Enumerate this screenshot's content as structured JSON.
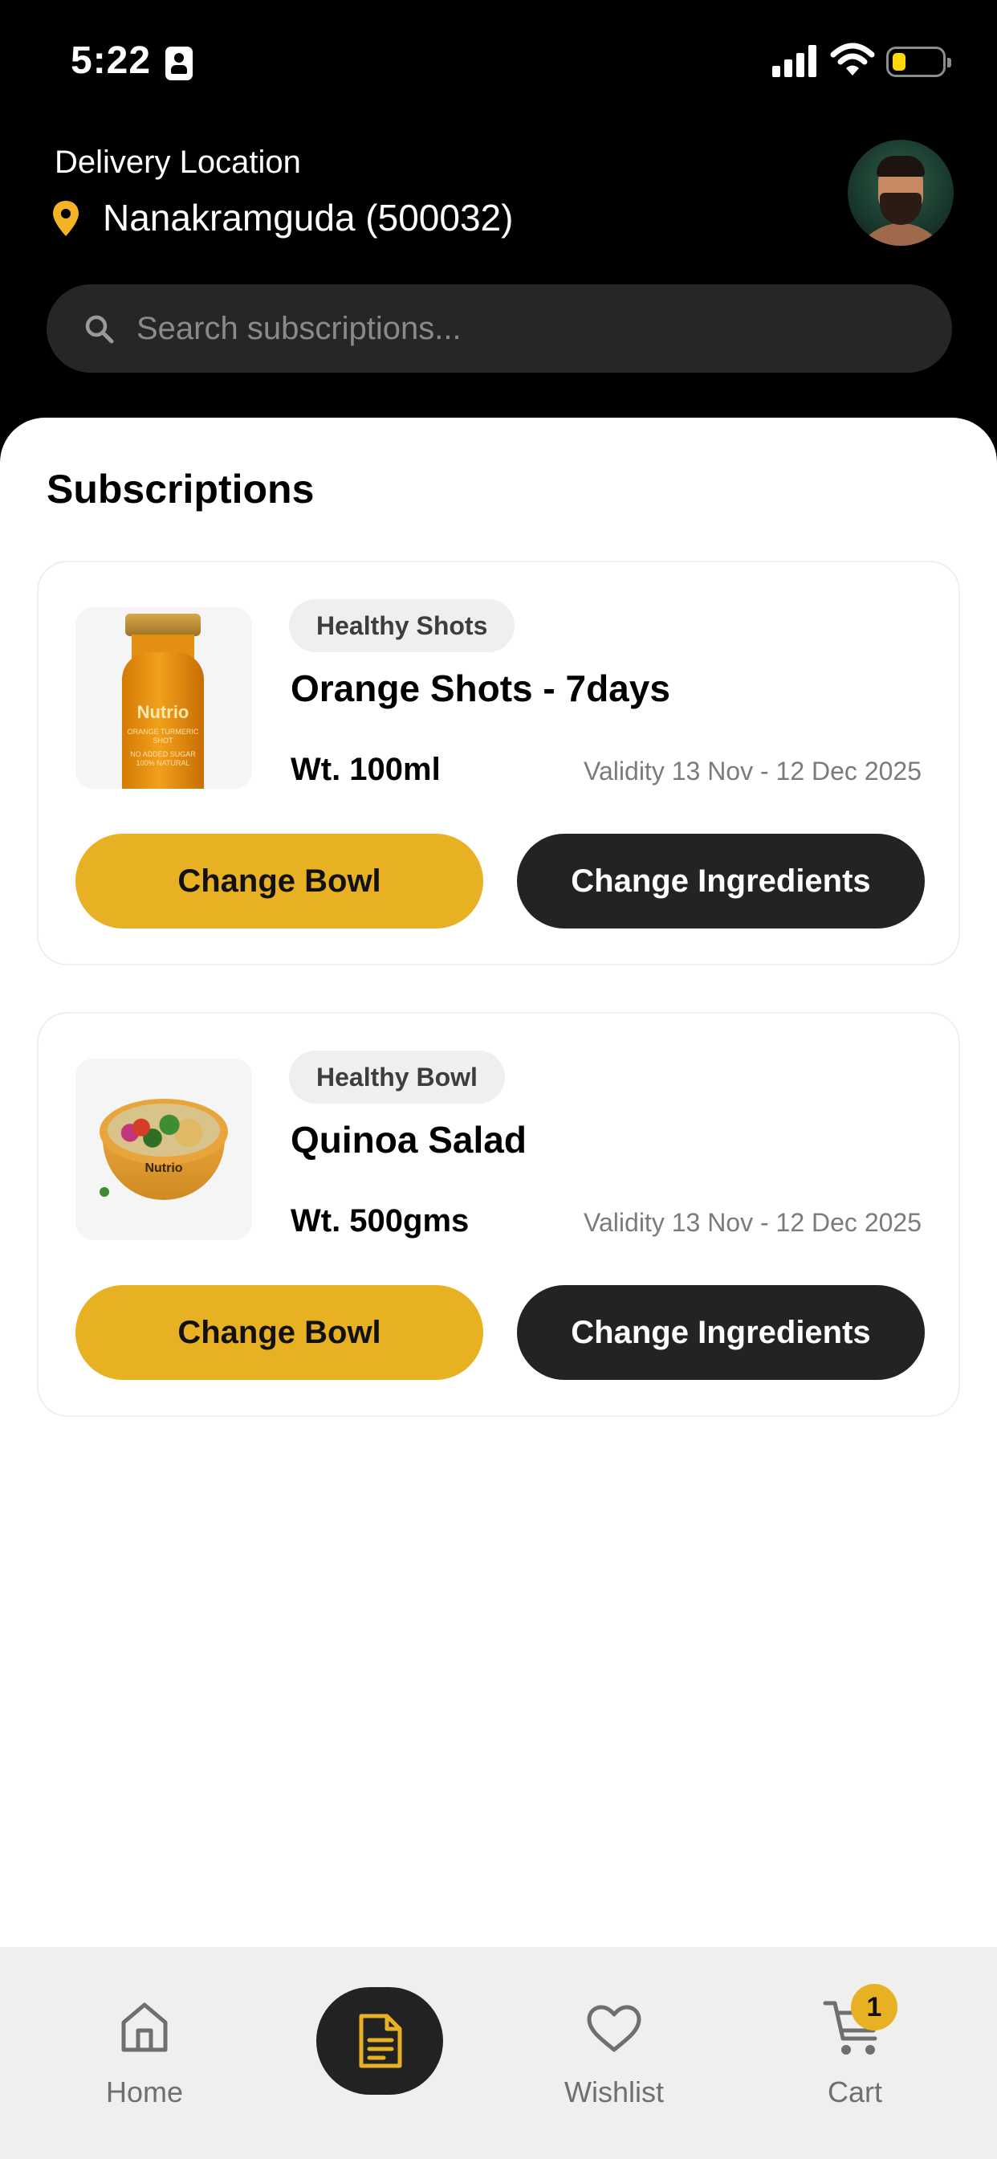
{
  "status_bar": {
    "time": "5:22"
  },
  "header": {
    "location_label": "Delivery Location",
    "location_value": "Nanakramguda (500032)",
    "location_icon": "pin-icon",
    "avatar": "user-avatar"
  },
  "search": {
    "placeholder": "Search subscriptions...",
    "icon": "search-icon"
  },
  "main": {
    "title": "Subscriptions",
    "cards": [
      {
        "tag": "Healthy Shots",
        "title": "Orange Shots - 7days",
        "weight": "Wt. 100ml",
        "validity": "Validity 13 Nov - 12 Dec 2025",
        "image": "orange-shot-bottle",
        "image_text": {
          "brand": "Nutrio",
          "product": "ORANGE TURMERIC SHOT",
          "note": "NO ADDED SUGAR 100% NATURAL"
        },
        "primary_button": "Change Bowl",
        "secondary_button": "Change Ingredients"
      },
      {
        "tag": "Healthy Bowl",
        "title": "Quinoa Salad",
        "weight": "Wt. 500gms",
        "validity": "Validity 13 Nov - 12 Dec 2025",
        "image": "quinoa-salad-bowl",
        "image_text": {
          "brand": "Nutrio"
        },
        "primary_button": "Change Bowl",
        "secondary_button": "Change Ingredients"
      }
    ]
  },
  "bottom_nav": {
    "items": [
      {
        "label": "Home",
        "icon": "home-icon"
      },
      {
        "label": "",
        "icon": "subscriptions-icon",
        "active": true
      },
      {
        "label": "Wishlist",
        "icon": "heart-icon"
      },
      {
        "label": "Cart",
        "icon": "cart-icon"
      }
    ],
    "cart_count": "1"
  },
  "colors": {
    "accent": "#e8b124",
    "dark": "#232323",
    "header_bg": "#000000",
    "nav_bg": "#efefed"
  }
}
